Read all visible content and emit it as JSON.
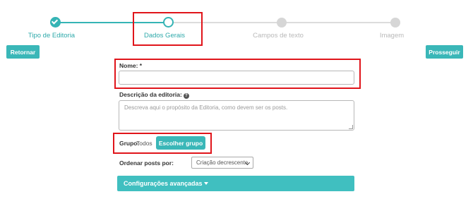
{
  "stepper": {
    "steps": [
      {
        "label": "Tipo de Editoria",
        "state": "done",
        "icon": "check-icon"
      },
      {
        "label": "Dados Gerais",
        "state": "current"
      },
      {
        "label": "Campos de texto",
        "state": "todo"
      },
      {
        "label": "Imagem",
        "state": "todo"
      }
    ]
  },
  "nav": {
    "back_label": "Retornar",
    "next_label": "Prosseguir"
  },
  "form": {
    "name_label": "Nome: *",
    "name_value": "",
    "description_label": "Descrição da editoria:",
    "description_placeholder": "Descreva aqui o propósito da Editoria, como devem ser os posts.",
    "group_label": "Grupo:",
    "group_value": "Todos",
    "group_button_label": "Escolher grupo",
    "order_label": "Ordenar posts por:",
    "order_selected": "Criação decrescente",
    "advanced_label": "Configurações avançadas"
  },
  "colors": {
    "accent": "#3ab7b8",
    "highlight": "#e0151b",
    "inactive": "#d6d6d6"
  }
}
